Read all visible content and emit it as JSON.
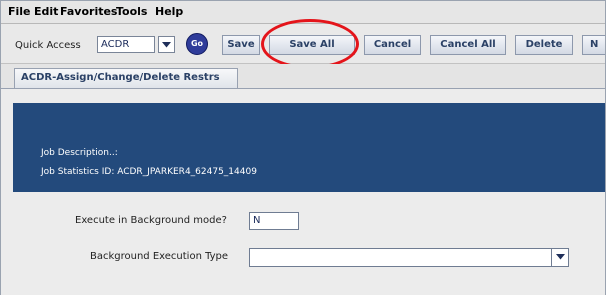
{
  "menu": [
    "File",
    "Edit",
    "Favorites",
    "Tools",
    "Help"
  ],
  "toolbar": {
    "quick_access_label": "Quick Access",
    "quick_access_value": "ACDR",
    "go_label": "Go",
    "buttons": [
      "Save",
      "Save All",
      "Cancel",
      "Cancel All",
      "Delete",
      "N"
    ]
  },
  "tab": {
    "label": "ACDR-Assign/Change/Delete Restrs"
  },
  "header": {
    "job_description": "Job Description..:",
    "job_statistics": "Job Statistics ID:  ACDR_JPARKER4_62475_14409"
  },
  "form": {
    "background_mode_label": "Execute in Background mode?",
    "background_mode_value": "N",
    "execution_type_label": "Background Execution Type",
    "execution_type_value": ""
  },
  "colors": {
    "band": "#234a7c",
    "highlight_circle": "#e4141a",
    "go_button": "#2f3c9a"
  }
}
